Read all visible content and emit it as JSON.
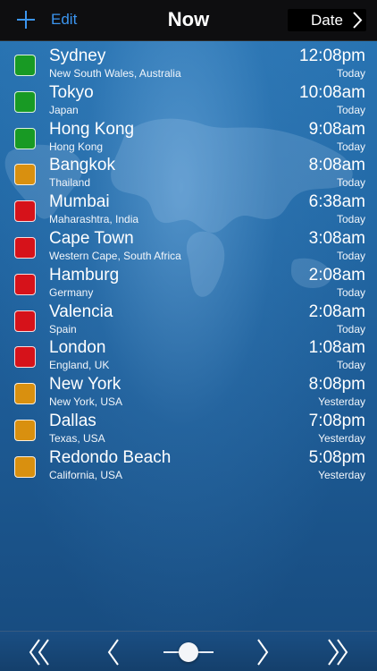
{
  "header": {
    "add_icon": "plus-icon",
    "edit_label": "Edit",
    "title": "Now",
    "date_label": "Date",
    "date_icon": "chevron-right-icon"
  },
  "colors": {
    "accent": "#3b95f0",
    "status_green": "#189a24",
    "status_orange": "#d9900f",
    "status_red": "#d6121a"
  },
  "cities": [
    {
      "name": "Sydney",
      "region": "New South Wales, Australia",
      "time": "12:08pm",
      "day": "Today",
      "status_color": "#189a24"
    },
    {
      "name": "Tokyo",
      "region": "Japan",
      "time": "10:08am",
      "day": "Today",
      "status_color": "#189a24"
    },
    {
      "name": "Hong Kong",
      "region": "Hong Kong",
      "time": "9:08am",
      "day": "Today",
      "status_color": "#189a24"
    },
    {
      "name": "Bangkok",
      "region": "Thailand",
      "time": "8:08am",
      "day": "Today",
      "status_color": "#d9900f"
    },
    {
      "name": "Mumbai",
      "region": "Maharashtra, India",
      "time": "6:38am",
      "day": "Today",
      "status_color": "#d6121a"
    },
    {
      "name": "Cape Town",
      "region": "Western Cape, South Africa",
      "time": "3:08am",
      "day": "Today",
      "status_color": "#d6121a"
    },
    {
      "name": "Hamburg",
      "region": "Germany",
      "time": "2:08am",
      "day": "Today",
      "status_color": "#d6121a"
    },
    {
      "name": "Valencia",
      "region": "Spain",
      "time": "2:08am",
      "day": "Today",
      "status_color": "#d6121a"
    },
    {
      "name": "London",
      "region": "England, UK",
      "time": "1:08am",
      "day": "Today",
      "status_color": "#d6121a"
    },
    {
      "name": "New York",
      "region": "New York, USA",
      "time": "8:08pm",
      "day": "Yesterday",
      "status_color": "#d9900f"
    },
    {
      "name": "Dallas",
      "region": "Texas, USA",
      "time": "7:08pm",
      "day": "Yesterday",
      "status_color": "#d9900f"
    },
    {
      "name": "Redondo Beach",
      "region": "California, USA",
      "time": "5:08pm",
      "day": "Yesterday",
      "status_color": "#d9900f"
    }
  ],
  "toolbar": {
    "icons": [
      "double-chevron-left-icon",
      "chevron-left-icon",
      "time-slider",
      "chevron-right-icon",
      "double-chevron-right-icon"
    ]
  }
}
